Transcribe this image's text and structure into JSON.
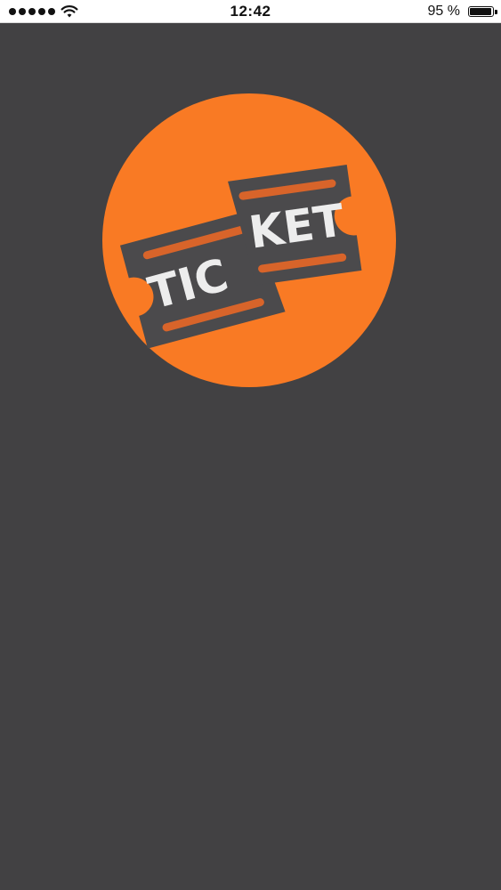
{
  "status_bar": {
    "time": "12:42",
    "battery_percent_text": "95 %",
    "battery_level": 0.95,
    "signal_dots": 5
  },
  "logo": {
    "text_left": "TIC",
    "text_right": "KET",
    "circle_color": "#F97A24",
    "ticket_color": "#4B4A4C",
    "stripe_color": "#D8642A",
    "text_color": "#EDEDED"
  },
  "colors": {
    "background": "#424143",
    "status_bar": "#FFFFFF"
  }
}
